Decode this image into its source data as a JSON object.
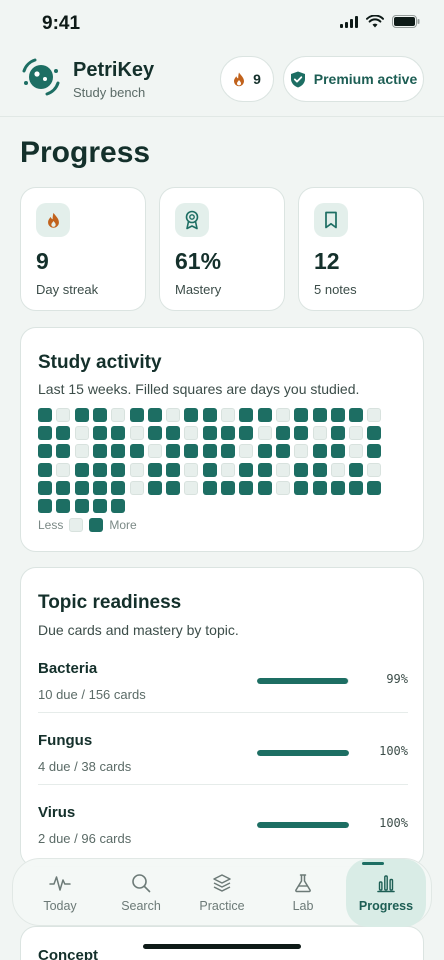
{
  "status_bar": {
    "time": "9:41"
  },
  "header": {
    "app_name": "PetriKey",
    "subtitle": "Study bench",
    "streak_count": "9",
    "premium_label": "Premium active"
  },
  "page_title": "Progress",
  "stats": [
    {
      "icon": "flame-icon",
      "value": "9",
      "label": "Day streak"
    },
    {
      "icon": "award-icon",
      "value": "61%",
      "label": "Mastery"
    },
    {
      "icon": "bookmark-icon",
      "value": "12",
      "label": "5 notes"
    }
  ],
  "activity": {
    "title": "Study activity",
    "subtitle": "Last 15 weeks. Filled squares are days you studied.",
    "legend_less": "Less",
    "legend_more": "More",
    "rows": [
      [
        1,
        0,
        1,
        1,
        0,
        1,
        1,
        0,
        1,
        1,
        0,
        1,
        1,
        0,
        1,
        1,
        1,
        1,
        0
      ],
      [
        1,
        1,
        0,
        1,
        1,
        0,
        1,
        1,
        0,
        1,
        1,
        1,
        0,
        1,
        1,
        0,
        1,
        0,
        1
      ],
      [
        1,
        1,
        0,
        1,
        1,
        1,
        0,
        1,
        1,
        1,
        1,
        0,
        1,
        1,
        0,
        1,
        1,
        0,
        1
      ],
      [
        1,
        0,
        1,
        1,
        1,
        0,
        1,
        1,
        0,
        1,
        0,
        1,
        1,
        0,
        1,
        1,
        0,
        1,
        0
      ],
      [
        1,
        1,
        1,
        1,
        1,
        0,
        1,
        1,
        0,
        1,
        1,
        1,
        1,
        0,
        1,
        1,
        1,
        1,
        1
      ],
      [
        1,
        1,
        1,
        1,
        1,
        0,
        0,
        0,
        0,
        0,
        0,
        0,
        0,
        0,
        0,
        0,
        0,
        0,
        0
      ]
    ]
  },
  "topics": {
    "title": "Topic readiness",
    "subtitle": "Due cards and mastery by topic.",
    "items": [
      {
        "name": "Bacteria",
        "meta": "10 due / 156 cards",
        "pct_label": "99%",
        "pct": 99
      },
      {
        "name": "Fungus",
        "meta": "4 due / 38 cards",
        "pct_label": "100%",
        "pct": 100
      },
      {
        "name": "Virus",
        "meta": "2 due / 96 cards",
        "pct_label": "100%",
        "pct": 100
      }
    ]
  },
  "peek_title": "Concept",
  "tabs": [
    {
      "label": "Today",
      "icon": "pulse-icon",
      "active": false
    },
    {
      "label": "Search",
      "icon": "search-icon",
      "active": false
    },
    {
      "label": "Practice",
      "icon": "layers-icon",
      "active": false
    },
    {
      "label": "Lab",
      "icon": "flask-icon",
      "active": false
    },
    {
      "label": "Progress",
      "icon": "bar-chart-icon",
      "active": true
    }
  ],
  "colors": {
    "accent": "#1d6e63",
    "streak": "#c1621c",
    "background": "#f1f5f3"
  }
}
